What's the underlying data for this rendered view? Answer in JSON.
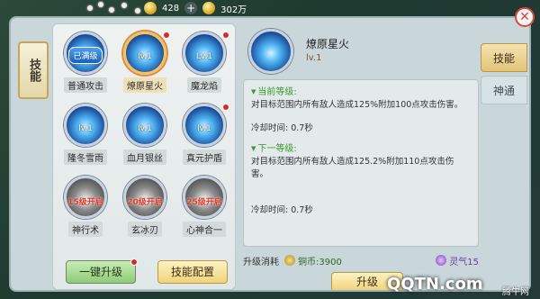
{
  "topbar": {
    "gold": "428",
    "silver": "302万"
  },
  "side_tab": "技能",
  "skills": [
    {
      "name": "普通攻击",
      "level": "Lv.1",
      "status": "已满级",
      "style": "blue",
      "dot": false,
      "selected": false
    },
    {
      "name": "燎原星火",
      "level": "lv.1",
      "status": "",
      "style": "blue",
      "dot": true,
      "selected": true
    },
    {
      "name": "魔龙焰",
      "level": "Lv.1",
      "status": "",
      "style": "blue",
      "dot": true,
      "selected": false
    },
    {
      "name": "隆冬雪雨",
      "level": "lv.1",
      "status": "",
      "style": "blue",
      "dot": false,
      "selected": false
    },
    {
      "name": "血月银丝",
      "level": "lv.1",
      "status": "",
      "style": "blue",
      "dot": false,
      "selected": false
    },
    {
      "name": "真元护盾",
      "level": "lv.1",
      "status": "",
      "style": "blue",
      "dot": true,
      "selected": false
    },
    {
      "name": "神行术",
      "level": "",
      "status": "15级开启",
      "style": "grey",
      "dot": false,
      "selected": false
    },
    {
      "name": "玄冰刃",
      "level": "",
      "status": "20级开启",
      "style": "grey",
      "dot": false,
      "selected": false
    },
    {
      "name": "心神合一",
      "level": "",
      "status": "25级开启",
      "style": "grey",
      "dot": false,
      "selected": false
    }
  ],
  "buttons": {
    "upgrade_all": "一键升级",
    "config": "技能配置",
    "upgrade": "升级"
  },
  "detail": {
    "name": "燎原星火",
    "level": "lv.1",
    "current_title": "当前等级:",
    "current_desc": "对目标范围内所有敌人造成125%附加100点攻击伤害。",
    "current_cd": "冷却时间: 0.7秒",
    "next_title": "下一等级:",
    "next_desc": "对目标范围内所有敌人造成125.2%附加110点攻击伤害。",
    "next_cd": "冷却时间: 0.7秒"
  },
  "cost": {
    "label": "升级消耗",
    "copper": "铜币:3900",
    "spirit": "灵气15"
  },
  "tabs": [
    {
      "label": "技能",
      "active": true
    },
    {
      "label": "神通",
      "active": false
    }
  ],
  "watermark": {
    "main": "QQTN.com",
    "cn": "腾牛网"
  }
}
